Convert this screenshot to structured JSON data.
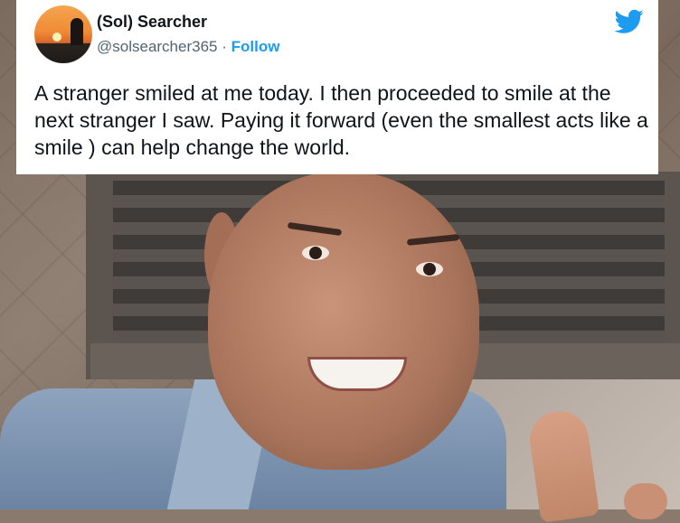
{
  "tweet": {
    "display_name": "(Sol) Searcher",
    "handle": "@solsearcher365",
    "separator": " · ",
    "follow_label": "Follow",
    "text": "A stranger smiled at me today.  I then proceeded to smile at the next stranger I saw.  Paying it forward (even the smallest acts like a smile ) can help change the world.",
    "icons": {
      "avatar": "sunset-silhouette-avatar",
      "brand": "twitter-bird-icon"
    },
    "colors": {
      "brand_blue": "#1d9bf0",
      "text": "#0f1419",
      "secondary_text": "#536471"
    }
  }
}
